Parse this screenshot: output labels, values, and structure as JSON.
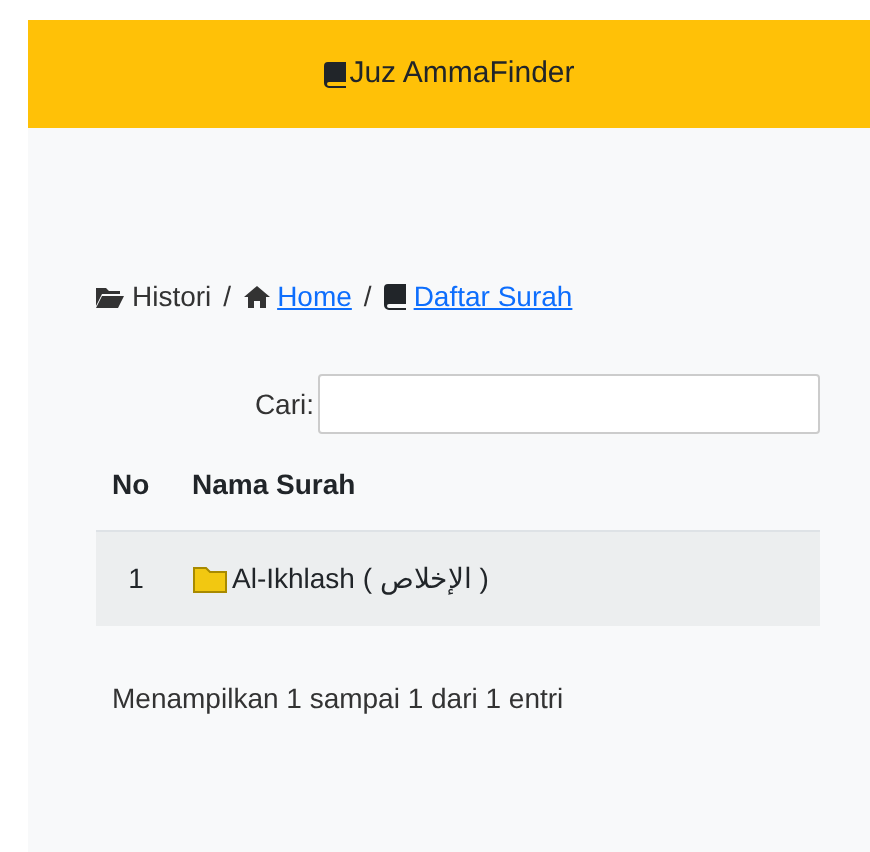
{
  "navbar": {
    "brand": "Juz AmmaFinder"
  },
  "breadcrumb": [
    {
      "label": "Histori",
      "link": false
    },
    {
      "label": "Home",
      "link": true
    },
    {
      "label": "Daftar Surah",
      "link": true
    }
  ],
  "breadcrumb_separator": "/",
  "search": {
    "label": "Cari:"
  },
  "table": {
    "columns": [
      "No",
      "Nama Surah"
    ],
    "rows": [
      {
        "no": "1",
        "name": "Al-Ikhlash ( الإخلاص )"
      }
    ]
  },
  "info": "Menampilkan 1 sampai 1 dari 1 entri"
}
